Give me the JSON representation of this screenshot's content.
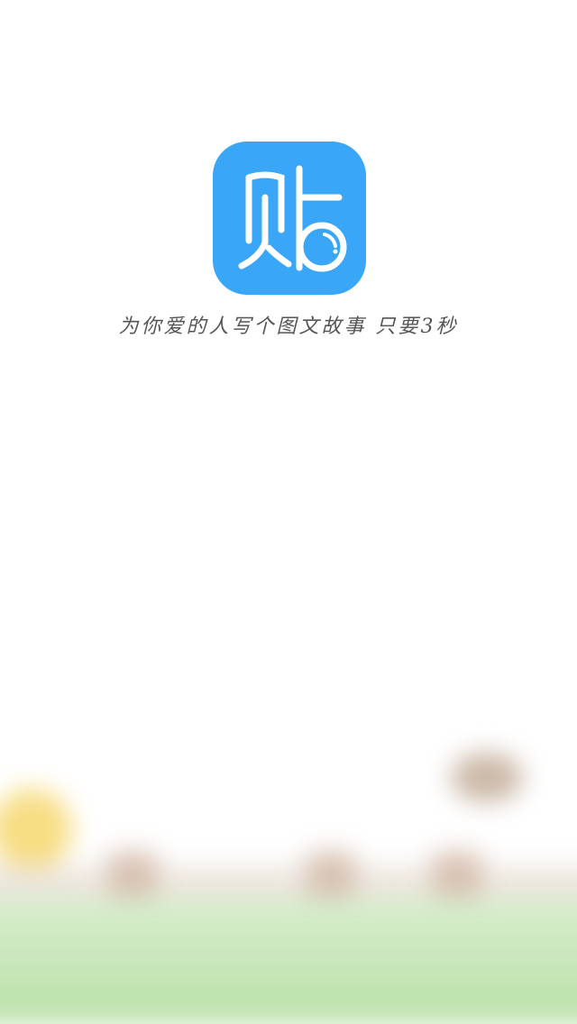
{
  "splash": {
    "app_icon": {
      "name": "贴-app-icon",
      "glyph": "贴",
      "background_color": "#3aa6f8",
      "foreground_color": "#ffffff"
    },
    "slogan": "为你爱的人写个图文故事 只要3秒",
    "background_scene": "blurred-illustration-sun-fence-grass"
  }
}
